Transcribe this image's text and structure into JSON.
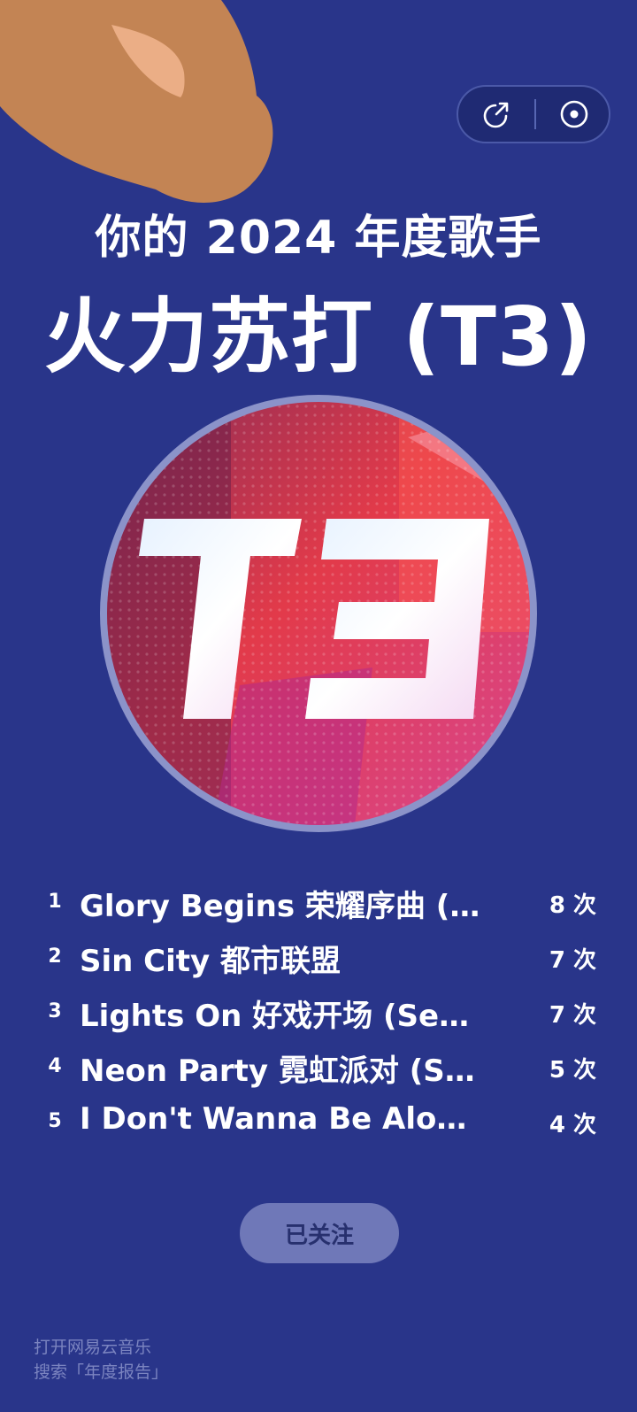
{
  "header": {
    "subtitle": "你的 2024 年度歌手",
    "artist": "火力苏打 (T3)"
  },
  "controls": {
    "share_icon": "share-icon",
    "vinyl_icon": "vinyl-disc-icon"
  },
  "cover": {
    "logo_text": "T3"
  },
  "songs": [
    {
      "rank": "1",
      "title": "Glory Begins 荣耀序曲 (S…",
      "count": "8 次"
    },
    {
      "rank": "2",
      "title": "Sin City 都市联盟",
      "count": "7 次"
    },
    {
      "rank": "3",
      "title": "Lights On 好戏开场 (Sea…",
      "count": "7 次"
    },
    {
      "rank": "4",
      "title": "Neon Party 霓虹派对 (Su…",
      "count": "5 次"
    },
    {
      "rank": "5",
      "title": "I Don't Wanna Be Alone…",
      "count": "4 次"
    }
  ],
  "follow_button": {
    "label": "已关注"
  },
  "footer": {
    "line1": "打开网易云音乐",
    "line2": "搜索「年度报告」"
  },
  "colors": {
    "background": "#29358a",
    "blob": "#c38454",
    "blob_highlight": "#ebae86",
    "follow_button": "#6f78b8"
  }
}
